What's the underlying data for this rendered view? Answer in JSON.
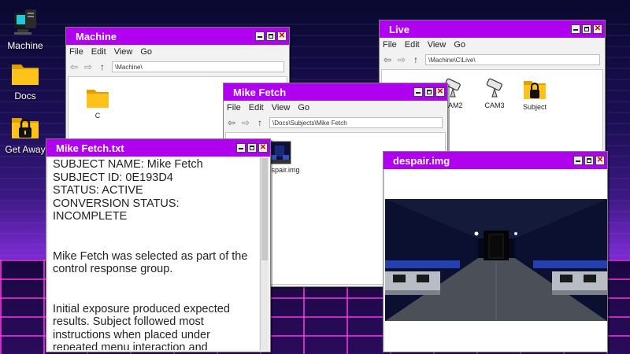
{
  "desktop": {
    "icons": [
      {
        "label": "Machine",
        "icon": "computer-icon"
      },
      {
        "label": "Docs",
        "icon": "folder-icon"
      },
      {
        "label": "Get Away",
        "icon": "lock-folder-icon"
      }
    ]
  },
  "menus": {
    "file": "File",
    "edit": "Edit",
    "view": "View",
    "go": "Go"
  },
  "windows": {
    "machine": {
      "title": "Machine",
      "address": "\\Machine\\",
      "items": [
        {
          "label": "C",
          "icon": "folder-icon"
        }
      ]
    },
    "live": {
      "title": "Live",
      "address": "\\Machine\\C\\Live\\",
      "items": [
        {
          "label": "CAM2",
          "icon": "camera-icon"
        },
        {
          "label": "CAM3",
          "icon": "camera-icon"
        },
        {
          "label": "Subject",
          "icon": "lock-folder-icon"
        }
      ]
    },
    "mike_fetch": {
      "title": "Mike Fetch",
      "address": "\\Docs\\Subjects\\Mike Fetch",
      "items": [
        {
          "label": "t despair.img",
          "icon": "image-file-icon"
        }
      ]
    },
    "text_file": {
      "title": "Mike Fetch.txt",
      "lines": [
        "SUBJECT NAME: Mike Fetch",
        "SUBJECT ID: 0E193D4",
        "STATUS: ACTIVE",
        "CONVERSION STATUS: INCOMPLETE",
        "Mike Fetch was selected as part of the control response group.",
        "Initial exposure produced expected results. Subject followed most instructions when placed under repeated menu interaction and environmental"
      ]
    },
    "viewer": {
      "title": "despair.img"
    }
  },
  "colors": {
    "titlebar": "#b000f0",
    "window_bg": "#f2f2f2"
  }
}
